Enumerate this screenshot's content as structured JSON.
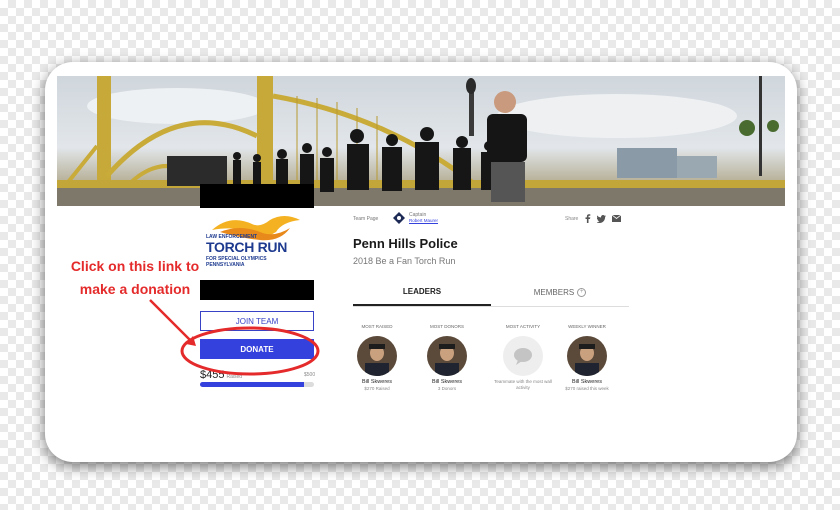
{
  "banner": {
    "alt": "Officers running across a yellow bridge with a torch"
  },
  "logo": {
    "line1": "LAW ENFORCEMENT",
    "line2": "TORCH RUN",
    "line3": "FOR SPECIAL OLYMPICS",
    "line4": "PENNSYLVANIA"
  },
  "sidebar": {
    "join_label": "JOIN TEAM",
    "donate_label": "DONATE",
    "raised_amount": "$455",
    "raised_label": "Raised",
    "goal": "$500",
    "progress_fraction": 0.91
  },
  "annotation": {
    "line1": "Click on this link to",
    "line2": "make a donation"
  },
  "team": {
    "team_page_label": "Team Page",
    "captain_label": "Captain",
    "captain_name": "Robert Maurer",
    "name": "Penn Hills Police",
    "event": "2018 Be a Fan Torch Run",
    "share_label": "Share"
  },
  "tabs": {
    "leaders": "LEADERS",
    "members": "MEMBERS"
  },
  "leaders": [
    {
      "label": "MOST RAISED",
      "name": "Bill Skweres",
      "stat": "$270 Raised"
    },
    {
      "label": "MOST DONORS",
      "name": "Bill Skweres",
      "stat": "3 Donors"
    },
    {
      "label": "MOST ACTIVITY",
      "name": "",
      "stat": "Teammate with the most wall activity"
    },
    {
      "label": "WEEKLY WINNER",
      "name": "Bill Skweres",
      "stat": "$270 raised this week"
    }
  ],
  "colors": {
    "accent": "#3541dd",
    "annotation": "#e42a2a"
  }
}
